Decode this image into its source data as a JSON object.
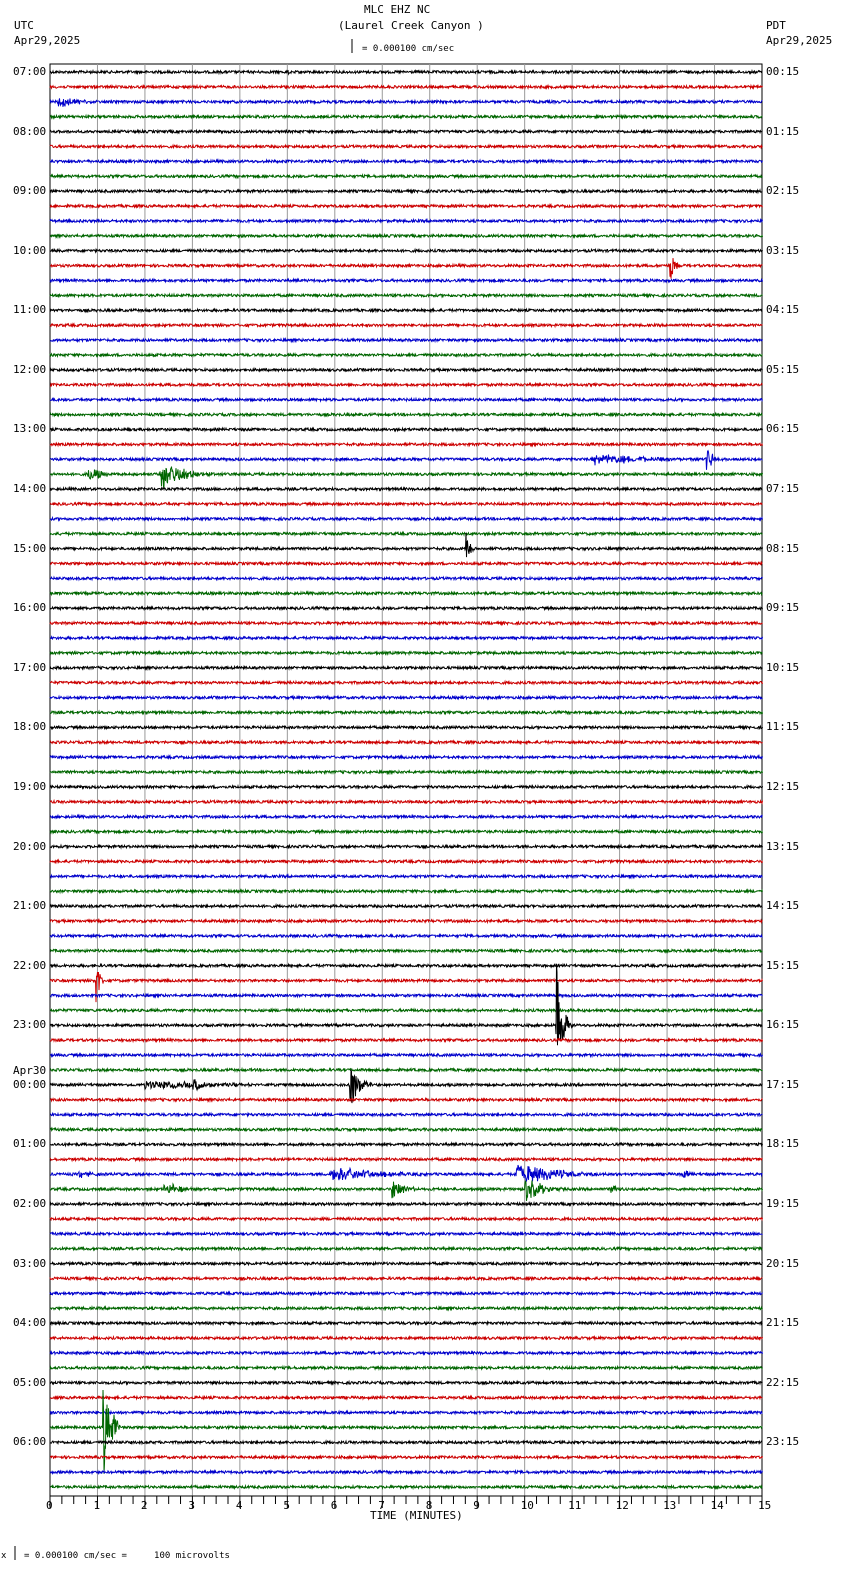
{
  "header": {
    "title": "MLC EHZ NC",
    "subtitle": "(Laurel Creek Canyon )",
    "left_tz": "UTC",
    "left_date": "Apr29,2025",
    "right_tz": "PDT",
    "right_date": "Apr29,2025",
    "scale": "= 0.000100 cm/sec"
  },
  "footer": {
    "scale_note": "= 0.000100 cm/sec =     100 microvolts",
    "prefix": "x"
  },
  "colors": [
    "#000000",
    "#cc0000",
    "#0000cc",
    "#006600"
  ],
  "chart_data": {
    "type": "line",
    "title": "MLC EHZ NC (Laurel Creek Canyon )",
    "xlabel": "TIME (MINUTES)",
    "xlim": [
      0,
      15
    ],
    "x_ticks": [
      "0",
      "1",
      "2",
      "3",
      "4",
      "5",
      "6",
      "7",
      "8",
      "9",
      "10",
      "11",
      "12",
      "13",
      "14",
      "15"
    ],
    "traces_per_hour": 4,
    "num_traces": 96,
    "left_labels": [
      "07:00",
      "08:00",
      "09:00",
      "10:00",
      "11:00",
      "12:00",
      "13:00",
      "14:00",
      "15:00",
      "16:00",
      "17:00",
      "18:00",
      "19:00",
      "20:00",
      "21:00",
      "22:00",
      "23:00",
      "00:00",
      "01:00",
      "02:00",
      "03:00",
      "04:00",
      "05:00",
      "06:00"
    ],
    "date_change_label": "Apr30",
    "right_labels": [
      "00:15",
      "01:15",
      "02:15",
      "03:15",
      "04:15",
      "05:15",
      "06:15",
      "07:15",
      "08:15",
      "09:15",
      "10:15",
      "11:15",
      "12:15",
      "13:15",
      "14:15",
      "15:15",
      "16:15",
      "17:15",
      "18:15",
      "19:15",
      "20:15",
      "21:15",
      "22:15",
      "23:15"
    ],
    "events": [
      {
        "trace": 0,
        "start": 5.0,
        "end": 5.2,
        "amp": 4
      },
      {
        "trace": 2,
        "start": 0.15,
        "end": 1.4,
        "amp": 9
      },
      {
        "trace": 13,
        "start": 13.05,
        "end": 13.3,
        "amp": 28
      },
      {
        "trace": 22,
        "start": 11.65,
        "end": 11.75,
        "amp": 8
      },
      {
        "trace": 26,
        "start": 11.4,
        "end": 15,
        "amp": 8
      },
      {
        "trace": 26,
        "start": 13.8,
        "end": 14.1,
        "amp": 30
      },
      {
        "trace": 27,
        "start": 0.8,
        "end": 1.8,
        "amp": 10
      },
      {
        "trace": 27,
        "start": 2.3,
        "end": 3.8,
        "amp": 18
      },
      {
        "trace": 32,
        "start": 8.75,
        "end": 8.95,
        "amp": 30
      },
      {
        "trace": 61,
        "start": 0.95,
        "end": 1.15,
        "amp": 55
      },
      {
        "trace": 64,
        "start": 10.65,
        "end": 11.0,
        "amp": 80
      },
      {
        "trace": 68,
        "start": 2.0,
        "end": 8.5,
        "amp": 5
      },
      {
        "trace": 68,
        "start": 3.0,
        "end": 3.6,
        "amp": 12
      },
      {
        "trace": 68,
        "start": 6.3,
        "end": 6.8,
        "amp": 45
      },
      {
        "trace": 74,
        "start": 0.6,
        "end": 1.7,
        "amp": 5
      },
      {
        "trace": 74,
        "start": 5.9,
        "end": 9.0,
        "amp": 10
      },
      {
        "trace": 74,
        "start": 9.8,
        "end": 12.2,
        "amp": 16
      },
      {
        "trace": 74,
        "start": 13.3,
        "end": 13.7,
        "amp": 9
      },
      {
        "trace": 75,
        "start": 2.4,
        "end": 3.4,
        "amp": 11
      },
      {
        "trace": 75,
        "start": 7.2,
        "end": 8.0,
        "amp": 16
      },
      {
        "trace": 75,
        "start": 10.0,
        "end": 11.0,
        "amp": 20
      },
      {
        "trace": 75,
        "start": 11.8,
        "end": 12.3,
        "amp": 9
      },
      {
        "trace": 91,
        "start": 1.1,
        "end": 1.5,
        "amp": 90
      }
    ]
  }
}
